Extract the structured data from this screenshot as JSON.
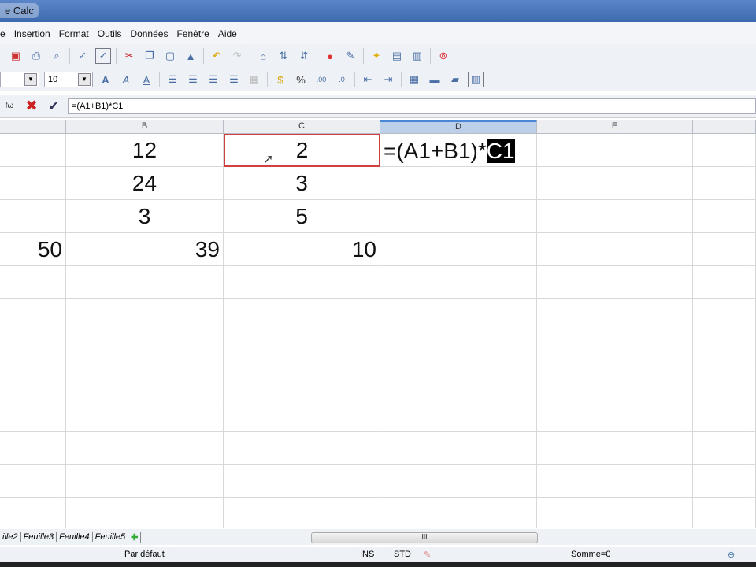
{
  "window": {
    "title": "e Calc"
  },
  "menu": [
    "e",
    "Insertion",
    "Format",
    "Outils",
    "Données",
    "Fenêtre",
    "Aide"
  ],
  "format_bar": {
    "font_size": "10"
  },
  "formula_bar": {
    "content": "=(A1+B1)*C1"
  },
  "columns": [
    "B",
    "C",
    "D",
    "E"
  ],
  "cells": {
    "row1": {
      "B": "12",
      "C": "2"
    },
    "row2": {
      "B": "24",
      "C": "3"
    },
    "row3": {
      "B": "3",
      "C": "5"
    },
    "row4": {
      "A": "50",
      "B": "39",
      "C": "10"
    }
  },
  "editing": {
    "prefix": "=(A1+B1)*",
    "selected": "C1"
  },
  "sheet_tabs": [
    "ille2",
    "Feuille3",
    "Feuille4",
    "Feuille5"
  ],
  "status": {
    "page_style": "Par défaut",
    "mode": "INS",
    "selection": "STD",
    "sum": "Somme=0"
  }
}
